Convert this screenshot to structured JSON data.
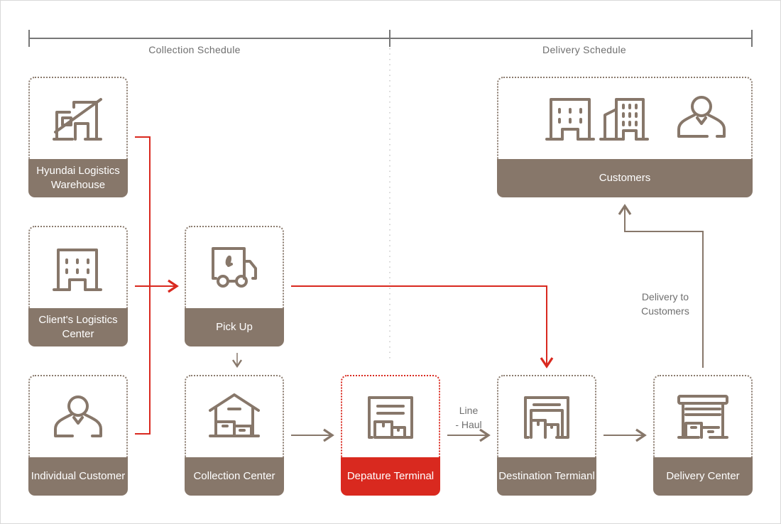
{
  "headers": {
    "collection": "Collection Schedule",
    "delivery": "Delivery Schedule"
  },
  "colors": {
    "brown": "#87776a",
    "red": "#d9291f",
    "text_gray": "#6f6f6f"
  },
  "nodes": {
    "warehouse": {
      "label": "Hyundai Logistics Warehouse",
      "icon": "warehouse-icon"
    },
    "client_center": {
      "label": "Client's Logistics Center",
      "icon": "office-building-icon"
    },
    "individual": {
      "label": "Individual Customer",
      "icon": "person-icon"
    },
    "pickup": {
      "label": "Pick Up",
      "icon": "truck-icon"
    },
    "collection_center": {
      "label": "Collection Center",
      "icon": "house-with-boxes-icon"
    },
    "departure_terminal": {
      "label": "Depature Terminal",
      "icon": "terminal-boxes-icon"
    },
    "destination_terminal": {
      "label": "Destination Termianl",
      "icon": "terminal-boxes-icon"
    },
    "delivery_center": {
      "label": "Delivery Center",
      "icon": "store-boxes-icon"
    },
    "customers": {
      "label": "Customers",
      "icons": [
        "office-building-icon",
        "tall-building-icon",
        "person-icon"
      ]
    }
  },
  "annotations": {
    "line_haul_1": "Line",
    "line_haul_2": "- Haul",
    "delivery_to_1": "Delivery to",
    "delivery_to_2": "Customers"
  }
}
